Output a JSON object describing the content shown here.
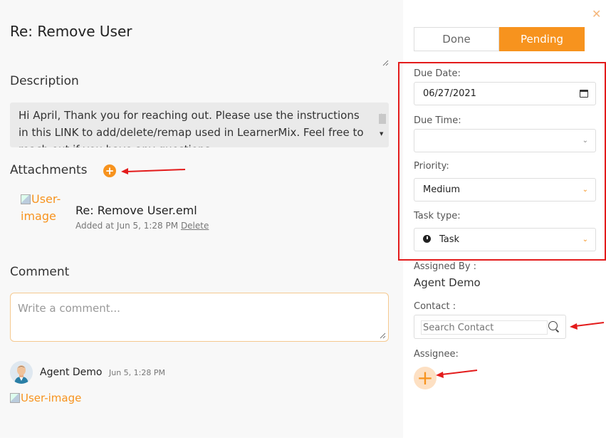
{
  "task": {
    "title": "Re: Remove User",
    "description_heading": "Description",
    "description_text": "Hi April, Thank you for reaching out. Please use the instructions in this LINK to add/delete/remap used in LearnerMix. Feel free to reach out if you have any questions.",
    "attachments_heading": "Attachments",
    "comment_heading": "Comment",
    "comment_placeholder": "Write a comment..."
  },
  "attachment": {
    "image_alt": "User-image",
    "file_name": "Re: Remove User.eml",
    "added_text": "Added at Jun 5, 1:28 PM",
    "delete_label": "Delete"
  },
  "comment": {
    "author": "Agent Demo",
    "time": "Jun 5, 1:28 PM",
    "image_alt": "User-image"
  },
  "status": {
    "done_label": "Done",
    "pending_label": "Pending",
    "selected": "Pending"
  },
  "fields": {
    "due_date_label": "Due Date:",
    "due_date_value": "06/27/2021",
    "due_time_label": "Due Time:",
    "due_time_value": "",
    "priority_label": "Priority:",
    "priority_value": "Medium",
    "task_type_label": "Task type:",
    "task_type_value": "Task"
  },
  "assigned": {
    "label": "Assigned By :",
    "name": "Agent Demo"
  },
  "contact": {
    "label": "Contact :",
    "placeholder": "Search Contact"
  },
  "assignee": {
    "label": "Assignee:"
  },
  "colors": {
    "accent": "#f7931e",
    "highlight_box": "#e31b1b",
    "annotation_arrow": "#e31b1b"
  }
}
